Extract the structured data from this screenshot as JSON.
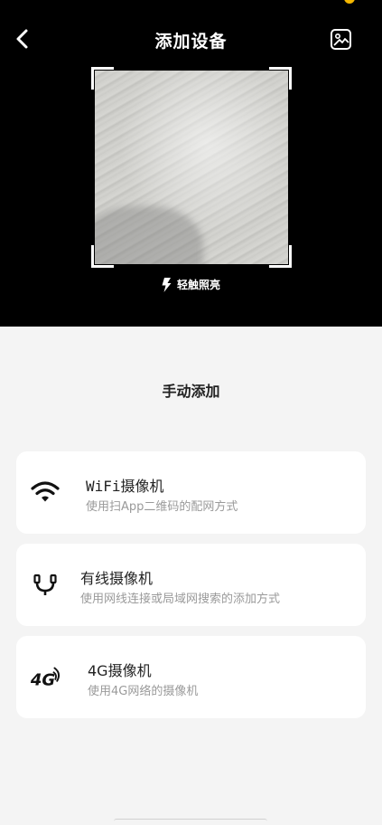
{
  "header": {
    "title": "添加设备"
  },
  "scanner": {
    "torch_label": "轻触照亮"
  },
  "manual": {
    "section_title": "手动添加",
    "options": [
      {
        "title": "WiFi摄像机",
        "subtitle": "使用扫App二维码的配网方式",
        "icon": "wifi-icon"
      },
      {
        "title": "有线摄像机",
        "subtitle": "使用网线连接或局域网搜索的添加方式",
        "icon": "ethernet-cable-icon"
      },
      {
        "title": "4G摄像机",
        "subtitle": "使用4G网络的摄像机",
        "icon": "4g-signal-icon"
      }
    ]
  },
  "colors": {
    "camera_bg": "#000000",
    "page_bg": "#f4f4f4",
    "card_bg": "#ffffff",
    "subtitle": "#9a9a9a"
  }
}
